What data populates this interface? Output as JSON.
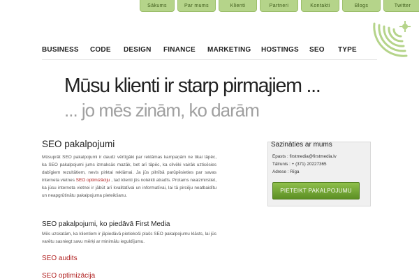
{
  "top_tabs": [
    "Sākums",
    "Par mums",
    "Klienti",
    "Partneri",
    "Kontakti",
    "Blogs",
    "Twitter"
  ],
  "main_nav": [
    "BUSINESS",
    "CODE",
    "DESIGN",
    "FINANCE",
    "MARKETING",
    "HOSTINGS",
    "SEO",
    "TYPE"
  ],
  "hero": {
    "line1": "Mūsu klienti ir starp pirmajiem ...",
    "line2": "... jo mēs zinām, ko darām"
  },
  "content": {
    "heading": "SEO pakalpojumi",
    "para1_before_link": "Mūsuprāt SEO pakalpojumi ir daudz vērtīgāki par reklāmas kampaņām ne tikai tāpēc, ka SEO pakalpojumi jums izmaksās mazāk, bet arī tāpēc, ka cilvēki vairāk uzticēsies dabīgiem rezultātiem, nevis pirktai reklāmai. Ja jūs pilnībā parūpēsieties par savas interneta vietnes",
    "para1_link": "SEO optimizāciju",
    "para1_after_link": ", tad klienti jūs noteikti atradīs. Protams neaizmirstiet, ka jūsu interneta vietnei ir jābūt arī kvalitatīvai un informatīvai, lai tā pircēju neatbaidītu un neapgrūtinātu pakalpojuma pieteikšanu.",
    "subheading": "SEO pakalpojumi, ko piedāvā First Media",
    "para2": "Mēs uzskatām, ka klientiem ir jāpiedāvā pietiekoši plašs SEO pakalpojumu klāsts, lai jūs varētu sasniegt savu mērķi ar minimālu ieguldījumu.",
    "link_heading_1": "SEO audits",
    "link_heading_2": "SEO optimizācija"
  },
  "contact": {
    "heading": "Sazināties ar mums",
    "email": "Epasts : firstmedia@firstmedia.lv",
    "phone": "Tālrunis : + (371) 20227365",
    "address": "Adrese : Rīga",
    "button": "PIETEIKT PAKALPOJUMU"
  },
  "colors": {
    "tab_green": "#b5d48a",
    "button_green": "#6fa334",
    "link_red": "#b02020",
    "hero_gray": "#a0a0a0"
  }
}
